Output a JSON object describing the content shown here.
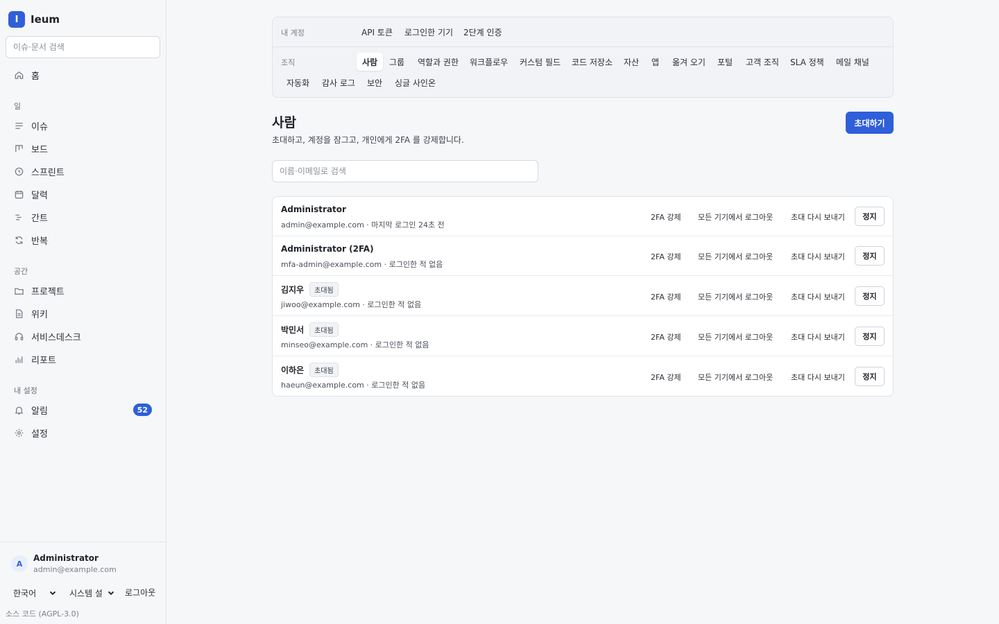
{
  "brand": {
    "logo_letter": "I",
    "name": "Ieum"
  },
  "sidebar": {
    "search_placeholder": "이슈·문서 검색",
    "home": {
      "label": "홈",
      "icon": "home-icon"
    },
    "sections": {
      "work": "일",
      "space": "공간",
      "my_settings": "내 설정"
    },
    "work_items": [
      {
        "label": "이슈",
        "icon": "list-icon"
      },
      {
        "label": "보드",
        "icon": "board-icon"
      },
      {
        "label": "스프린트",
        "icon": "clock-icon"
      },
      {
        "label": "달력",
        "icon": "calendar-icon"
      },
      {
        "label": "간트",
        "icon": "gantt-icon"
      },
      {
        "label": "반복",
        "icon": "repeat-icon"
      }
    ],
    "space_items": [
      {
        "label": "프로젝트",
        "icon": "folder-icon"
      },
      {
        "label": "위키",
        "icon": "document-icon"
      },
      {
        "label": "서비스데스크",
        "icon": "headset-icon"
      },
      {
        "label": "리포트",
        "icon": "bar-chart-icon"
      }
    ],
    "settings_items": [
      {
        "label": "알림",
        "icon": "bell-icon",
        "badge": "52"
      },
      {
        "label": "설정",
        "icon": "gear-icon"
      }
    ],
    "footer": {
      "avatar_letter": "A",
      "user_name": "Administrator",
      "user_email": "admin@example.com",
      "language": "한국어",
      "theme": "시스템 설",
      "logout": "로그아웃",
      "license": "소스 코드 (AGPL-3.0)"
    }
  },
  "tabs": {
    "account_label": "내 계정",
    "account_tabs": [
      "API 토큰",
      "로그인한 기기",
      "2단계 인증"
    ],
    "org_label": "조직",
    "org_tabs": [
      "사람",
      "그룹",
      "역할과 권한",
      "워크플로우",
      "커스텀 필드",
      "코드 저장소",
      "자산",
      "앱",
      "옮겨 오기",
      "포털",
      "고객 조직",
      "SLA 정책",
      "메일 채널",
      "자동화",
      "감사 로그",
      "보안",
      "싱글 사인온"
    ],
    "active_tab": "사람"
  },
  "page": {
    "title": "사람",
    "subtitle": "초대하고, 계정을 잠그고, 개인에게 2FA 를 강제합니다.",
    "invite_button": "초대하기",
    "search_placeholder": "이름·이메일로 검색"
  },
  "row_actions": {
    "force_2fa": "2FA 강제",
    "logout_all": "모든 기기에서 로그아웃",
    "resend_invite": "초대 다시 보내기",
    "suspend": "정지"
  },
  "people": [
    {
      "name": "Administrator",
      "tag": "",
      "meta": "admin@example.com · 마지막 로그인 24초 전",
      "resend": false
    },
    {
      "name": "Administrator (2FA)",
      "tag": "",
      "meta": "mfa-admin@example.com · 로그인한 적 없음",
      "resend": true
    },
    {
      "name": "김지우",
      "tag": "초대됨",
      "meta": "jiwoo@example.com · 로그인한 적 없음",
      "resend": true
    },
    {
      "name": "박민서",
      "tag": "초대됨",
      "meta": "minseo@example.com · 로그인한 적 없음",
      "resend": true
    },
    {
      "name": "이하은",
      "tag": "초대됨",
      "meta": "haeun@example.com · 로그인한 적 없음",
      "resend": true
    }
  ],
  "colors": {
    "accent": "#2f5fd9",
    "background": "#f6f7f9",
    "border": "#e1e4e8"
  }
}
